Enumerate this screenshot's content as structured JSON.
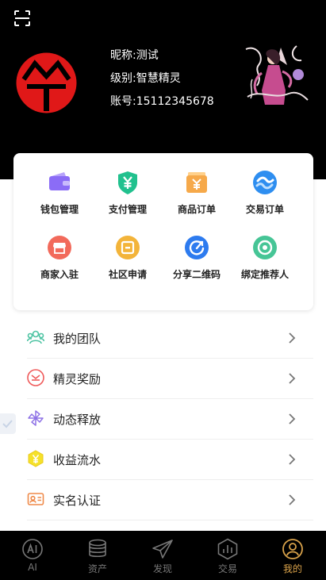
{
  "profile": {
    "nickname": "昵称:测试",
    "level": "级别:智慧精灵",
    "account": "账号:15112345678"
  },
  "grid": [
    {
      "label": "钱包管理",
      "icon": "wallet-icon",
      "color": "#8b6cf6"
    },
    {
      "label": "支付管理",
      "icon": "yen-shield-icon",
      "color": "#21c18e"
    },
    {
      "label": "商品订单",
      "icon": "yen-box-icon",
      "color": "#f6a94a"
    },
    {
      "label": "交易订单",
      "icon": "exchange-icon",
      "color": "#2e8ef0"
    },
    {
      "label": "商家入驻",
      "icon": "shop-icon",
      "color": "#f26a5b"
    },
    {
      "label": "社区申请",
      "icon": "community-icon",
      "color": "#f3b43a"
    },
    {
      "label": "分享二维码",
      "icon": "share-icon",
      "color": "#2d7bef"
    },
    {
      "label": "绑定推荐人",
      "icon": "bind-icon",
      "color": "#46c596"
    }
  ],
  "menu": [
    {
      "label": "我的团队",
      "icon": "team-icon"
    },
    {
      "label": "精灵奖励",
      "icon": "reward-icon"
    },
    {
      "label": "动态释放",
      "icon": "pinwheel-icon"
    },
    {
      "label": "收益流水",
      "icon": "yen-hexagon-icon"
    },
    {
      "label": "实名认证",
      "icon": "id-card-icon"
    }
  ],
  "tabs": [
    {
      "label": "AI",
      "icon": "ai-icon",
      "active": false
    },
    {
      "label": "资产",
      "icon": "coins-icon",
      "active": false
    },
    {
      "label": "发现",
      "icon": "paper-plane-icon",
      "active": false
    },
    {
      "label": "交易",
      "icon": "chart-hexagon-icon",
      "active": false
    },
    {
      "label": "我的",
      "icon": "user-icon",
      "active": true
    }
  ],
  "colors": {
    "header_bg": "#000000",
    "tab_active": "#d9a24a",
    "tab_inactive": "#777777"
  }
}
